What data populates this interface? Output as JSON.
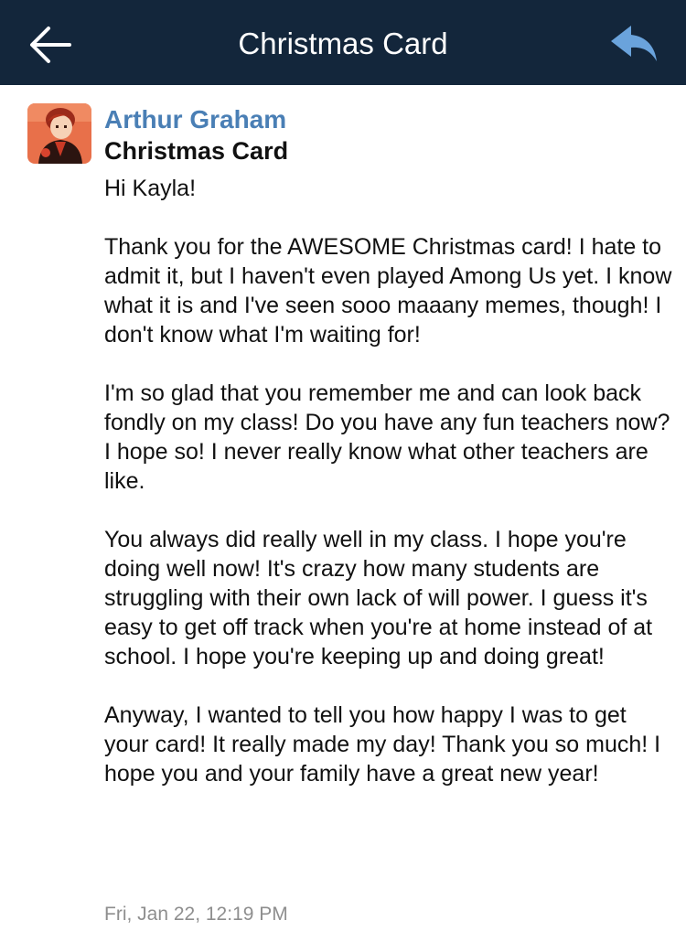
{
  "header": {
    "title": "Christmas Card",
    "back_icon": "arrow-left-icon",
    "reply_icon": "reply-arrow-icon",
    "background_color": "#13263b"
  },
  "message": {
    "sender": "Arthur Graham",
    "subject": "Christmas Card",
    "sender_color": "#4a7fb5",
    "paragraphs": [
      "Hi Kayla!",
      "Thank you for the AWESOME Christmas card! I hate to admit it, but I haven't even played Among Us yet. I know what it is and I've seen sooo maaany memes, though! I don't know what I'm waiting for!",
      "I'm so glad that you remember me and can look back fondly on my class! Do you have any fun teachers now? I hope so! I never really know what other teachers are like.",
      "You always did really well in my class. I hope you're doing well now! It's crazy how many students are struggling with their own lack of will power. I guess it's easy to get off track when you're at home instead of at school. I hope you're keeping up and doing great!",
      "Anyway, I wanted to tell you how happy I was to get your card! It really made my day! Thank you so much! I hope you and your family have a great new year!"
    ],
    "timestamp": "Fri, Jan 22, 12:19 PM"
  }
}
